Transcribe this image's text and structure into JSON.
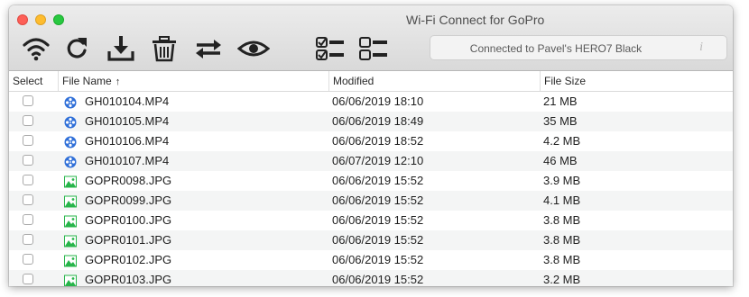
{
  "window": {
    "title": "Wi-Fi Connect for GoPro"
  },
  "toolbar": {
    "buttons": [
      {
        "icon": "wifi-icon"
      },
      {
        "icon": "refresh-icon"
      },
      {
        "icon": "download-icon"
      },
      {
        "icon": "trash-icon"
      },
      {
        "icon": "sync-icon"
      },
      {
        "icon": "eye-icon"
      },
      {
        "icon": "select-all-icon"
      },
      {
        "icon": "deselect-all-icon"
      }
    ],
    "status": "Connected to Pavel's HERO7 Black",
    "info_glyph": "i"
  },
  "table": {
    "headers": {
      "select": "Select",
      "name": "File Name",
      "sort_indicator": "↑",
      "modified": "Modified",
      "size": "File Size"
    },
    "rows": [
      {
        "type": "video",
        "name": "GH010104.MP4",
        "modified": "06/06/2019 18:10",
        "size": "21 MB"
      },
      {
        "type": "video",
        "name": "GH010105.MP4",
        "modified": "06/06/2019 18:49",
        "size": "35 MB"
      },
      {
        "type": "video",
        "name": "GH010106.MP4",
        "modified": "06/06/2019 18:52",
        "size": "4.2 MB"
      },
      {
        "type": "video",
        "name": "GH010107.MP4",
        "modified": "06/07/2019 12:10",
        "size": "46 MB"
      },
      {
        "type": "image",
        "name": "GOPR0098.JPG",
        "modified": "06/06/2019 15:52",
        "size": "3.9 MB"
      },
      {
        "type": "image",
        "name": "GOPR0099.JPG",
        "modified": "06/06/2019 15:52",
        "size": "4.1 MB"
      },
      {
        "type": "image",
        "name": "GOPR0100.JPG",
        "modified": "06/06/2019 15:52",
        "size": "3.8 MB"
      },
      {
        "type": "image",
        "name": "GOPR0101.JPG",
        "modified": "06/06/2019 15:52",
        "size": "3.8 MB"
      },
      {
        "type": "image",
        "name": "GOPR0102.JPG",
        "modified": "06/06/2019 15:52",
        "size": "3.8 MB"
      },
      {
        "type": "image",
        "name": "GOPR0103.JPG",
        "modified": "06/06/2019 15:52",
        "size": "3.2 MB"
      }
    ]
  },
  "colors": {
    "video_icon": "#2f6fd8",
    "image_icon": "#27b54a",
    "toolbar_icon": "#222222"
  }
}
